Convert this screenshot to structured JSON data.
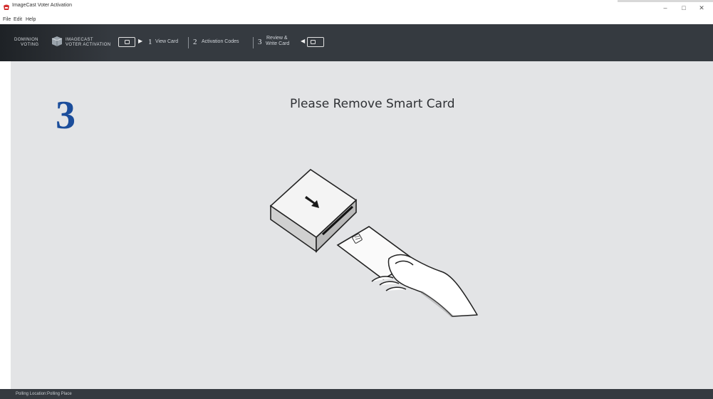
{
  "window": {
    "title": "ImageCast Voter Activation",
    "controls": {
      "minimize": "–",
      "maximize": "□",
      "close": "✕"
    }
  },
  "menu": {
    "items": [
      "File",
      "Edit",
      "Help"
    ]
  },
  "brand": {
    "line1_left": "DOMINION",
    "line2_left": "VOTING",
    "line1_right": "IMAGECAST",
    "line2_right": "VOTER ACTIVATION",
    "logo_icon": "dominion-logo-icon"
  },
  "steps": [
    {
      "number": "1",
      "label": "View Card"
    },
    {
      "number": "2",
      "label": "Activation Codes"
    },
    {
      "number": "3",
      "label_line1": "Review &",
      "label_line2": "Write Card"
    }
  ],
  "main": {
    "step_indicator": "3",
    "heading": "Please Remove Smart Card",
    "illustration_icon": "remove-smart-card-illustration"
  },
  "status": {
    "location_label": "Polling Location:",
    "location_value": "Polling Place"
  },
  "colors": {
    "toolbar": "#353a40",
    "content_bg": "#e3e4e6",
    "step_number": "#1b4d9b",
    "app_icon": "#d32f2f"
  }
}
